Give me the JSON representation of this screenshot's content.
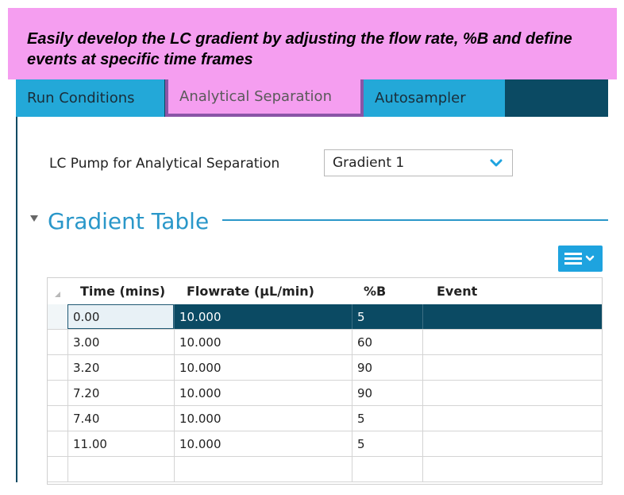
{
  "banner": {
    "line1": "Easily develop the LC gradient by adjusting the flow rate, %B and define",
    "line2": "events at specific time frames"
  },
  "tabs": [
    {
      "label": "Run Conditions"
    },
    {
      "label": "Analytical Separation",
      "active": true
    },
    {
      "label": "Autosampler"
    }
  ],
  "pump": {
    "label": "LC Pump for Analytical Separation",
    "selected": "Gradient 1"
  },
  "gradient_section": {
    "title": "Gradient Table"
  },
  "table": {
    "headers": [
      "Time (mins)",
      "Flowrate (µL/min)",
      "%B",
      "Event"
    ],
    "rows": [
      {
        "time": "0.00",
        "flow": "10.000",
        "b": "5",
        "event": ""
      },
      {
        "time": "3.00",
        "flow": "10.000",
        "b": "60",
        "event": ""
      },
      {
        "time": "3.20",
        "flow": "10.000",
        "b": "90",
        "event": ""
      },
      {
        "time": "7.20",
        "flow": "10.000",
        "b": "90",
        "event": ""
      },
      {
        "time": "7.40",
        "flow": "10.000",
        "b": "5",
        "event": ""
      },
      {
        "time": "11.00",
        "flow": "10.000",
        "b": "5",
        "event": ""
      },
      {
        "time": "",
        "flow": "",
        "b": "",
        "event": ""
      }
    ]
  },
  "colors": {
    "banner": "#f59ef0",
    "tab": "#23a8d8",
    "tab_bar": "#0b4a63",
    "accent": "#2a97c9",
    "selected_row": "#0b4a63"
  }
}
